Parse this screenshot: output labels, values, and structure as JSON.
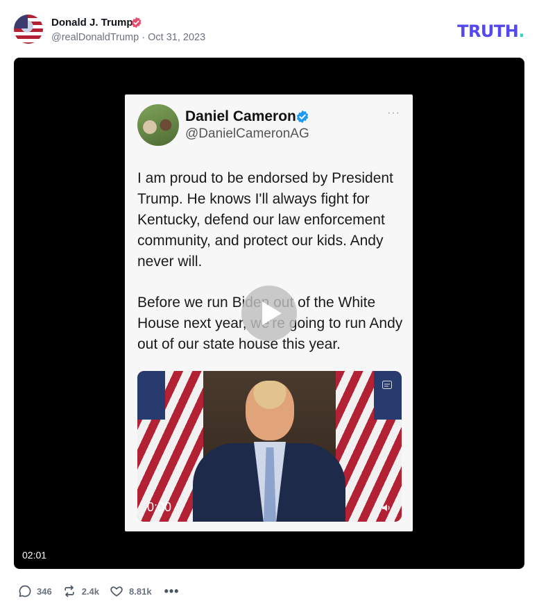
{
  "post": {
    "author_name": "Donald J. Trump",
    "handle": "@realDonaldTrump",
    "separator": "·",
    "date": "Oct 31, 2023",
    "brand": {
      "word": "TRUTH",
      "dot": ".",
      "color": "#5448ee",
      "dot_color": "#2dd4bf"
    },
    "verified_color": "#e54e6f"
  },
  "video": {
    "duration": "02:01",
    "frame": {
      "name": "Daniel Cameron",
      "handle": "@DanielCameronAG",
      "more": "···",
      "paragraphs": [
        "I am proud to be endorsed by President Trump. He knows I'll always fight for Kentucky, defend our law enforcement community, and protect our kids. Andy never will.",
        "Before we run Biden out of the White House next year, we're going to run Andy out of our state house this year."
      ],
      "inner_time": "0:00"
    }
  },
  "actions": {
    "replies": "346",
    "reposts": "2.4k",
    "likes": "8.81k",
    "more": "•••"
  }
}
